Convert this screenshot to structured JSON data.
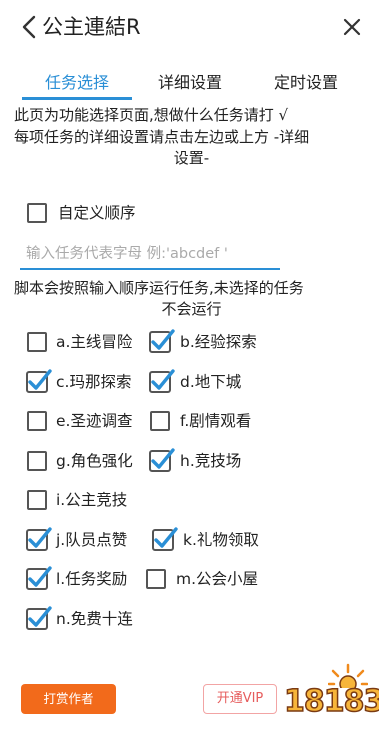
{
  "header": {
    "title": "公主連結R"
  },
  "tabs": [
    {
      "label": "任务选择",
      "active": true
    },
    {
      "label": "详细设置",
      "active": false
    },
    {
      "label": "定时设置",
      "active": false
    }
  ],
  "notes": {
    "line1": "此页为功能选择页面,想做什么任务请打 √",
    "line2a": "每项任务的详细设置请点击左边或上方 -详细",
    "line2b": "设置-"
  },
  "custom_order": {
    "label": "自定义顺序",
    "checked": false
  },
  "order_input": {
    "placeholder": "输入任务代表字母 例:'abcdef '"
  },
  "order_note": {
    "line1": "脚本会按照输入顺序运行任务,未选择的任务",
    "line2": "不会运行"
  },
  "tasks": [
    {
      "label": "a.主线冒险",
      "checked": false
    },
    {
      "label": "b.经验探索",
      "checked": true
    },
    {
      "label": "c.玛那探索",
      "checked": true
    },
    {
      "label": "d.地下城",
      "checked": true
    },
    {
      "label": "e.圣迹调查",
      "checked": false
    },
    {
      "label": "f.剧情观看",
      "checked": false
    },
    {
      "label": "g.角色强化",
      "checked": false
    },
    {
      "label": "h.竞技场",
      "checked": true
    },
    {
      "label": "i.公主竞技",
      "checked": false
    },
    {
      "label": "j.队员点赞",
      "checked": true
    },
    {
      "label": "k.礼物领取",
      "checked": true
    },
    {
      "label": "l.任务奖励",
      "checked": true
    },
    {
      "label": "m.公会小屋",
      "checked": false
    },
    {
      "label": "n.免费十连",
      "checked": true
    }
  ],
  "footer": {
    "reward_label": "打赏作者",
    "vip_label": "开通VIP"
  },
  "watermark": {
    "text": "18183"
  },
  "colors": {
    "accent": "#2a8fd6",
    "check": "#2a8fd6",
    "reward_button": "#f26a1b",
    "vip_text": "#e65c5c"
  }
}
